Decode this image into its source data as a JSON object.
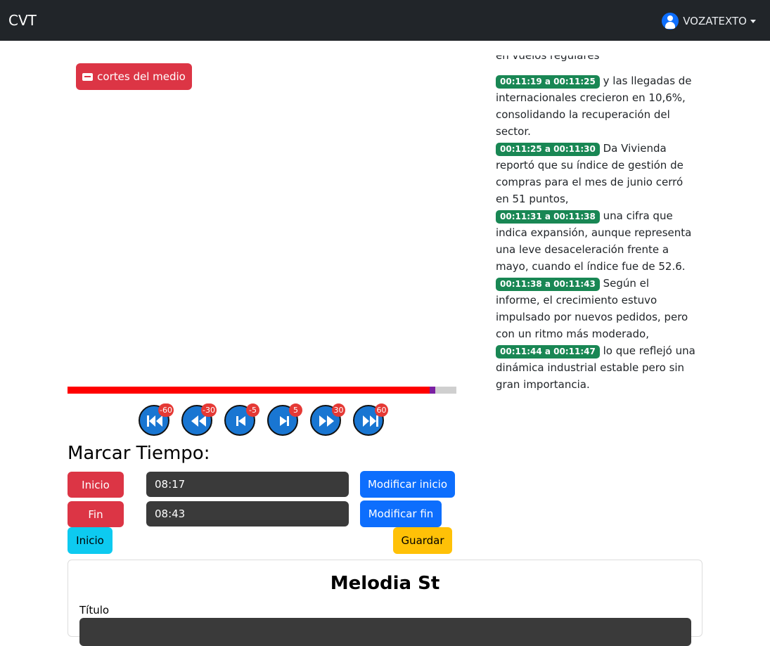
{
  "navbar": {
    "brand": "CVT",
    "user_label": "VOZATEXTO"
  },
  "media": {
    "cortes_label": "cortes del medio",
    "progress_fraction": 0.945
  },
  "transcript": {
    "clipped_line": "en vuelos regulares",
    "segments": [
      {
        "ts": "00:11:19 a 00:11:25",
        "text": "y las llegadas de internacionales crecieron en 10,6%, consolidando la recuperación del sector."
      },
      {
        "ts": "00:11:25 a 00:11:30",
        "text": "Da Vivienda reportó que su índice de gestión de compras para el mes de junio cerró en 51 puntos,"
      },
      {
        "ts": "00:11:31 a 00:11:38",
        "text": "una cifra que indica expansión, aunque representa una leve desaceleración frente a mayo, cuando el índice fue de 52.6."
      },
      {
        "ts": "00:11:38 a 00:11:43",
        "text": "Según el informe, el crecimiento estuvo impulsado por nuevos pedidos, pero con un ritmo más moderado,"
      },
      {
        "ts": "00:11:44 a 00:11:47",
        "text": "lo que reflejó una dinámica industrial estable pero sin gran importancia."
      }
    ]
  },
  "controls": [
    {
      "icon": "skip-back-60-icon",
      "badge": "-60"
    },
    {
      "icon": "rewind-30-icon",
      "badge": "-30"
    },
    {
      "icon": "step-back-5-icon",
      "badge": "-5"
    },
    {
      "icon": "step-forward-5-icon",
      "badge": "5"
    },
    {
      "icon": "fast-forward-30-icon",
      "badge": "30"
    },
    {
      "icon": "skip-forward-60-icon",
      "badge": "60"
    }
  ],
  "marcar": {
    "title": "Marcar Tiempo:",
    "inicio_label": "Inicio",
    "fin_label": "Fin",
    "inicio_value": "08:17",
    "fin_value": "08:43",
    "mod_inicio_label": "Modificar inicio",
    "mod_fin_label": "Modificar fin",
    "goto_inicio_label": "Inicio",
    "guardar_label": "Guardar"
  },
  "card": {
    "title": "Melodia St",
    "titulo_label": "Título"
  }
}
